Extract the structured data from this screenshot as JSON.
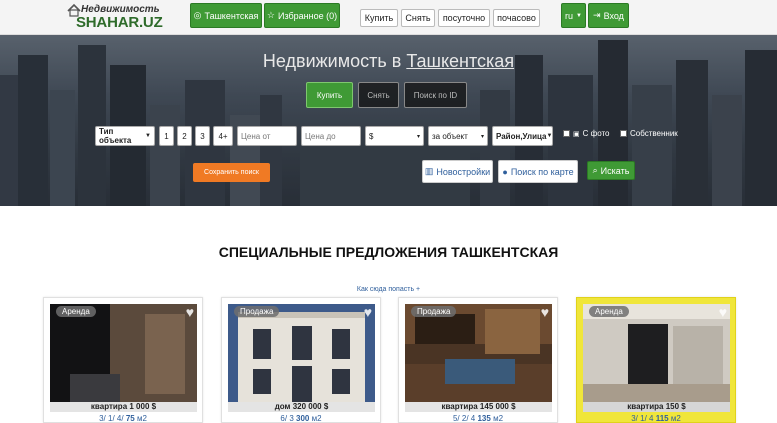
{
  "header": {
    "logo_top": "Недвижимость",
    "logo_bottom": "SHAHAR.UZ",
    "city_button": "Ташкентская",
    "favorites_button": "Избранное (0)",
    "nav": [
      "Купить",
      "Снять",
      "посуточно",
      "почасово"
    ],
    "lang": "ru",
    "login": "Вход"
  },
  "hero": {
    "title_prefix": "Недвижимость в",
    "title_city": "Ташкентская",
    "tabs": [
      "Купить",
      "Снять",
      "Поиск по ID"
    ],
    "type_select": "Тип объекта",
    "rooms": [
      "1",
      "2",
      "3",
      "4+"
    ],
    "price_from_placeholder": "Цена от",
    "price_to_placeholder": "Цена до",
    "currency": "$",
    "per": "за объект",
    "district": "Район,Улица",
    "with_photo": "С фото",
    "owner": "Собственник",
    "save_search": "Сохранить поиск",
    "new_buildings": "Новостройки",
    "map_search": "Поиск по карте",
    "search_button": "Искать"
  },
  "section": {
    "title": "СПЕЦИАЛЬНЫЕ ПРЕДЛОЖЕНИЯ ТАШКЕНТСКАЯ",
    "howto": "Как сюда попасть +"
  },
  "cards": [
    {
      "badge": "Аренда",
      "title": "квартира",
      "price": "1 000 $",
      "rooms": "3",
      "floor": "1",
      "floors": "4",
      "area": "75",
      "unit": "м2"
    },
    {
      "badge": "Продажа",
      "title": "дом",
      "price": "320 000 $",
      "rooms": "6",
      "floor": "",
      "floors": "3",
      "area": "300",
      "unit": "м2"
    },
    {
      "badge": "Продажа",
      "title": "квартира",
      "price": "145 000 $",
      "rooms": "5",
      "floor": "2",
      "floors": "4",
      "area": "135",
      "unit": "м2"
    },
    {
      "badge": "Аренда",
      "title": "квартира",
      "price": "150 $",
      "rooms": "3",
      "floor": "1",
      "floors": "4",
      "area": "115",
      "unit": "м2"
    }
  ],
  "colors": {
    "brand_green": "#3f9a35",
    "highlight_yellow": "#f0e63a",
    "orange": "#f07a24",
    "link_blue": "#2f5f9c"
  }
}
